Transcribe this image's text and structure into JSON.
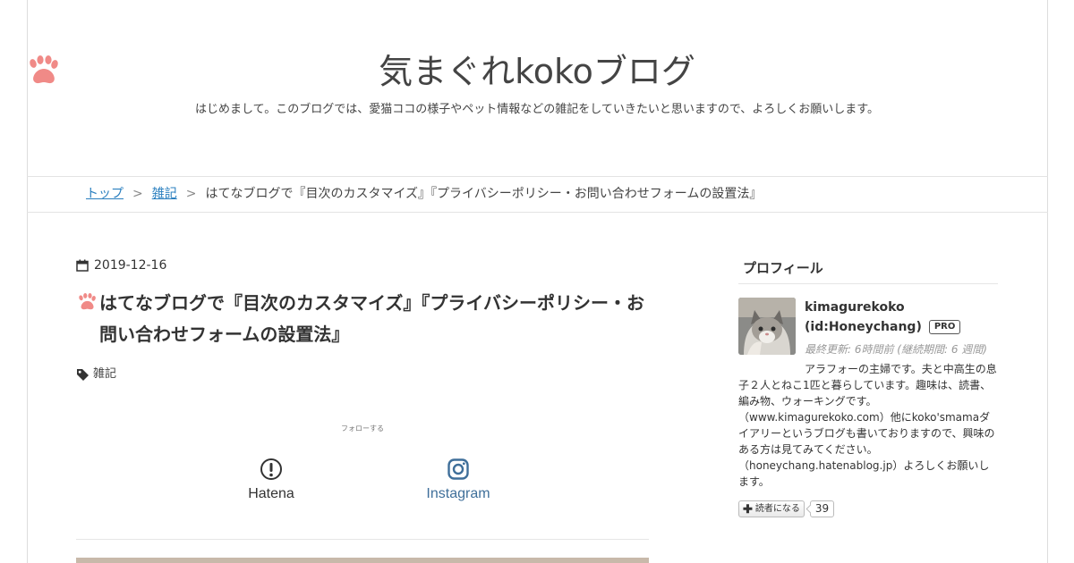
{
  "header": {
    "title": "気まぐれkokoブログ",
    "description": "はじめまして。このブログでは、愛猫ココの様子やペット情報などの雑記をしていきたいと思いますので、よろしくお願いします。",
    "logo_icon": "paw-icon",
    "accent_color": "#f08a87"
  },
  "breadcrumb": {
    "home": "トップ",
    "separator": ">",
    "category": "雑記",
    "current": "はてなブログで『目次のカスタマイズ』『プライバシーポリシー・お問い合わせフォームの設置法』"
  },
  "entry": {
    "date": "2019-12-16",
    "title": "はてなブログで『目次のカスタマイズ』『プライバシーポリシー・お問い合わせフォームの設置法』",
    "category": "雑記",
    "follow_label": "フォローする",
    "follow_buttons": [
      {
        "label": "Hatena",
        "icon": "hatena-icon"
      },
      {
        "label": "Instagram",
        "icon": "instagram-icon"
      }
    ]
  },
  "sidebar": {
    "profile": {
      "heading": "プロフィール",
      "name": "kimagurekoko",
      "id": "(id:Honeychang)",
      "badge": "PRO",
      "last_updated": "最終更新: 6時間前 (継続期間: 6 週間)",
      "description": "アラフォーの主婦です。夫と中高生の息子２人とねこ1匹と暮らしています。趣味は、読書、編み物、ウォーキングです。（www.kimagurekoko.com）他にkoko'smamaダイアリーというブログも書いておりますので、興味のある方は見てみてください。（honeychang.hatenablog.jp）よろしくお願いします。",
      "reader_button": "読者になる",
      "reader_count": "39"
    }
  }
}
